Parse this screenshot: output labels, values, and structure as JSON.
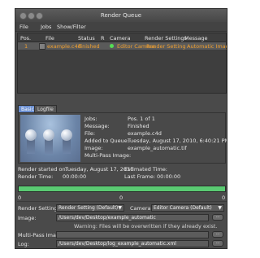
{
  "window": {
    "title": "Render Queue"
  },
  "menu": [
    "File",
    "Jobs",
    "Show/Filter"
  ],
  "table": {
    "headers": [
      "Pos.",
      "File",
      "Status",
      "R",
      "Camera",
      "Render Settings",
      "Message"
    ],
    "rows": [
      {
        "pos": "1",
        "file": "example.c4d",
        "status": "Finished",
        "camera": "Editor Camera",
        "render_settings": "Render Setting",
        "message": "Automatic Image"
      }
    ]
  },
  "tabs": [
    "Basic",
    "Logfile"
  ],
  "info": {
    "jobs_label": "Jobs:",
    "jobs_value": "Pos. 1 of 1",
    "message_label": "Message:",
    "message_value": "Finished",
    "file_label": "File:",
    "file_value": "example.c4d",
    "added_label": "Added to Queue:",
    "added_value": "Tuesday, August 17, 2010, 6:40:21 PM",
    "image_label": "Image:",
    "image_value": "example_automatic.tif",
    "multipass_label": "Multi-Pass Image:",
    "multipass_value": ""
  },
  "timing": {
    "render_started_label": "Render started on:",
    "render_started_value": "Tuesday, August 17, 2010",
    "estimated_label": "Estimated Time:",
    "estimated_value": "–",
    "render_time_label": "Render Time:",
    "render_time_value": "00:00:00",
    "last_frame_label": "Last Frame:",
    "last_frame_value": "00:00:00"
  },
  "progress": {
    "fraction": 1.0,
    "left_label": "0",
    "mid_label": "0",
    "right_label": "0"
  },
  "settings": {
    "render_settings_label": "Render Settings",
    "render_settings_value": "Render Setting (Default)",
    "camera_label": "Camera",
    "camera_value": "Editor Camera (Default)",
    "image_label": "Image:",
    "image_path": "/Users/dev/Desktop/example_automatic",
    "warning": "Warning: Files will be overwritten if they already exist.",
    "multipass_label": "Multi-Pass Image:",
    "multipass_path": "",
    "log_label": "Log:",
    "log_path": "/Users/dev/Desktop/log_example_automatic.xml",
    "browse_label": "..."
  }
}
